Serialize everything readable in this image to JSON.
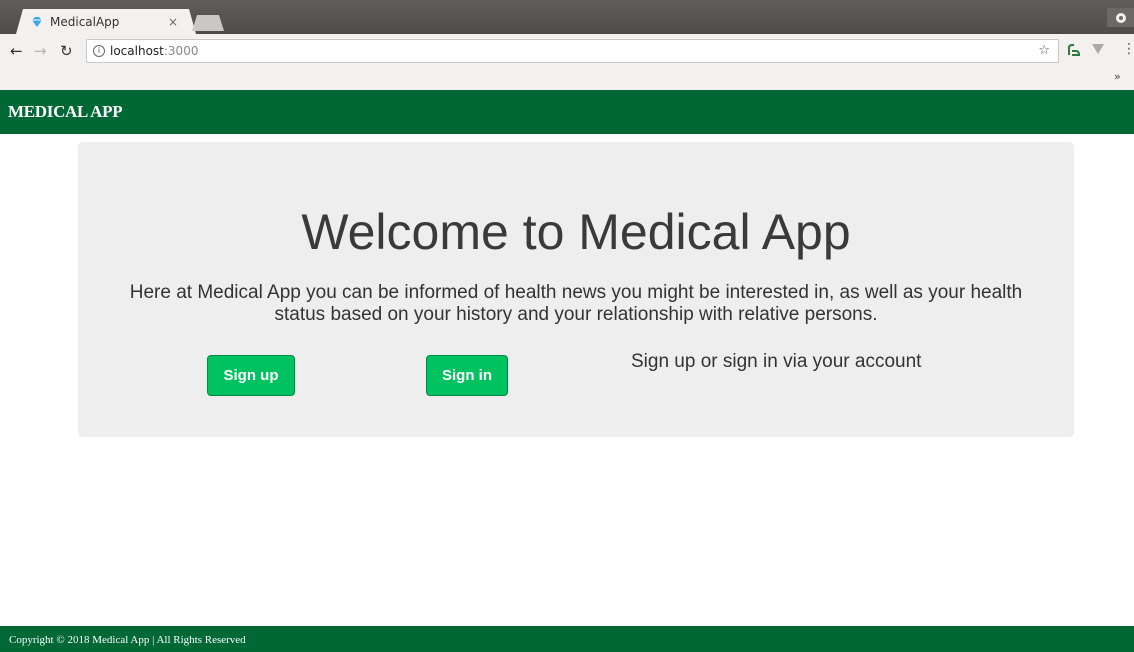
{
  "browser": {
    "tab_title": "MedicalApp",
    "tab_close": "×",
    "url_host": "localhost",
    "url_port": ":3000",
    "icons": {
      "back": "arrow-left-icon",
      "forward": "arrow-right-icon",
      "reload": "reload-icon",
      "info": "info-icon",
      "bookmark": "star-icon",
      "menu": "kebab-menu-icon"
    },
    "bookmarks_overflow": "»"
  },
  "navbar": {
    "brand": "MEDICAL APP",
    "color": "#006835"
  },
  "hero": {
    "title": "Welcome to Medical App",
    "lead": "Here at Medical App you can be informed of health news you might be interested in, as well as your health status based on your history and your relationship with relative persons.",
    "signup_label": "Sign up",
    "signin_label": "Sign in",
    "hint": "Sign up or sign in via your account",
    "button_color": "#00c260"
  },
  "footer": {
    "copyright": "Copyright © 2018 Medical App | All Rights Reserved"
  }
}
